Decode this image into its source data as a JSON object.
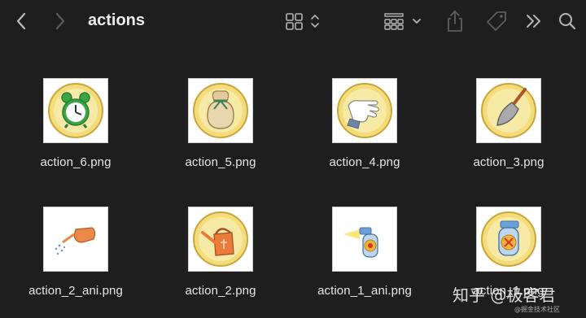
{
  "window": {
    "title": "actions"
  },
  "toolbar": {
    "back_icon": "chevron-left-icon",
    "forward_icon": "chevron-right-icon",
    "view_icon": "icon-grid-view-icon",
    "group_icon": "group-by-icon",
    "share_icon": "share-icon",
    "tag_icon": "tag-icon",
    "more_icon": "double-chevron-icon",
    "search_icon": "search-icon"
  },
  "files": [
    {
      "name": "action_6.png",
      "art": "alarm-clock"
    },
    {
      "name": "action_5.png",
      "art": "seed-bag"
    },
    {
      "name": "action_4.png",
      "art": "glove-hand"
    },
    {
      "name": "action_3.png",
      "art": "trowel"
    },
    {
      "name": "action_2_ani.png",
      "art": "watering-can-pouring"
    },
    {
      "name": "action_2.png",
      "art": "watering-can"
    },
    {
      "name": "action_1_ani.png",
      "art": "spray-bottle-spraying"
    },
    {
      "name": "action_1.png",
      "art": "spray-bottle"
    }
  ],
  "watermark": {
    "text": "知乎 @极客君",
    "subtext": "@掘金技术社区"
  },
  "colors": {
    "background": "#1e1e1e",
    "text": "#e6e6e6",
    "icon_gray": "#9a9a9a",
    "badge_gold": "#e8c94a"
  }
}
